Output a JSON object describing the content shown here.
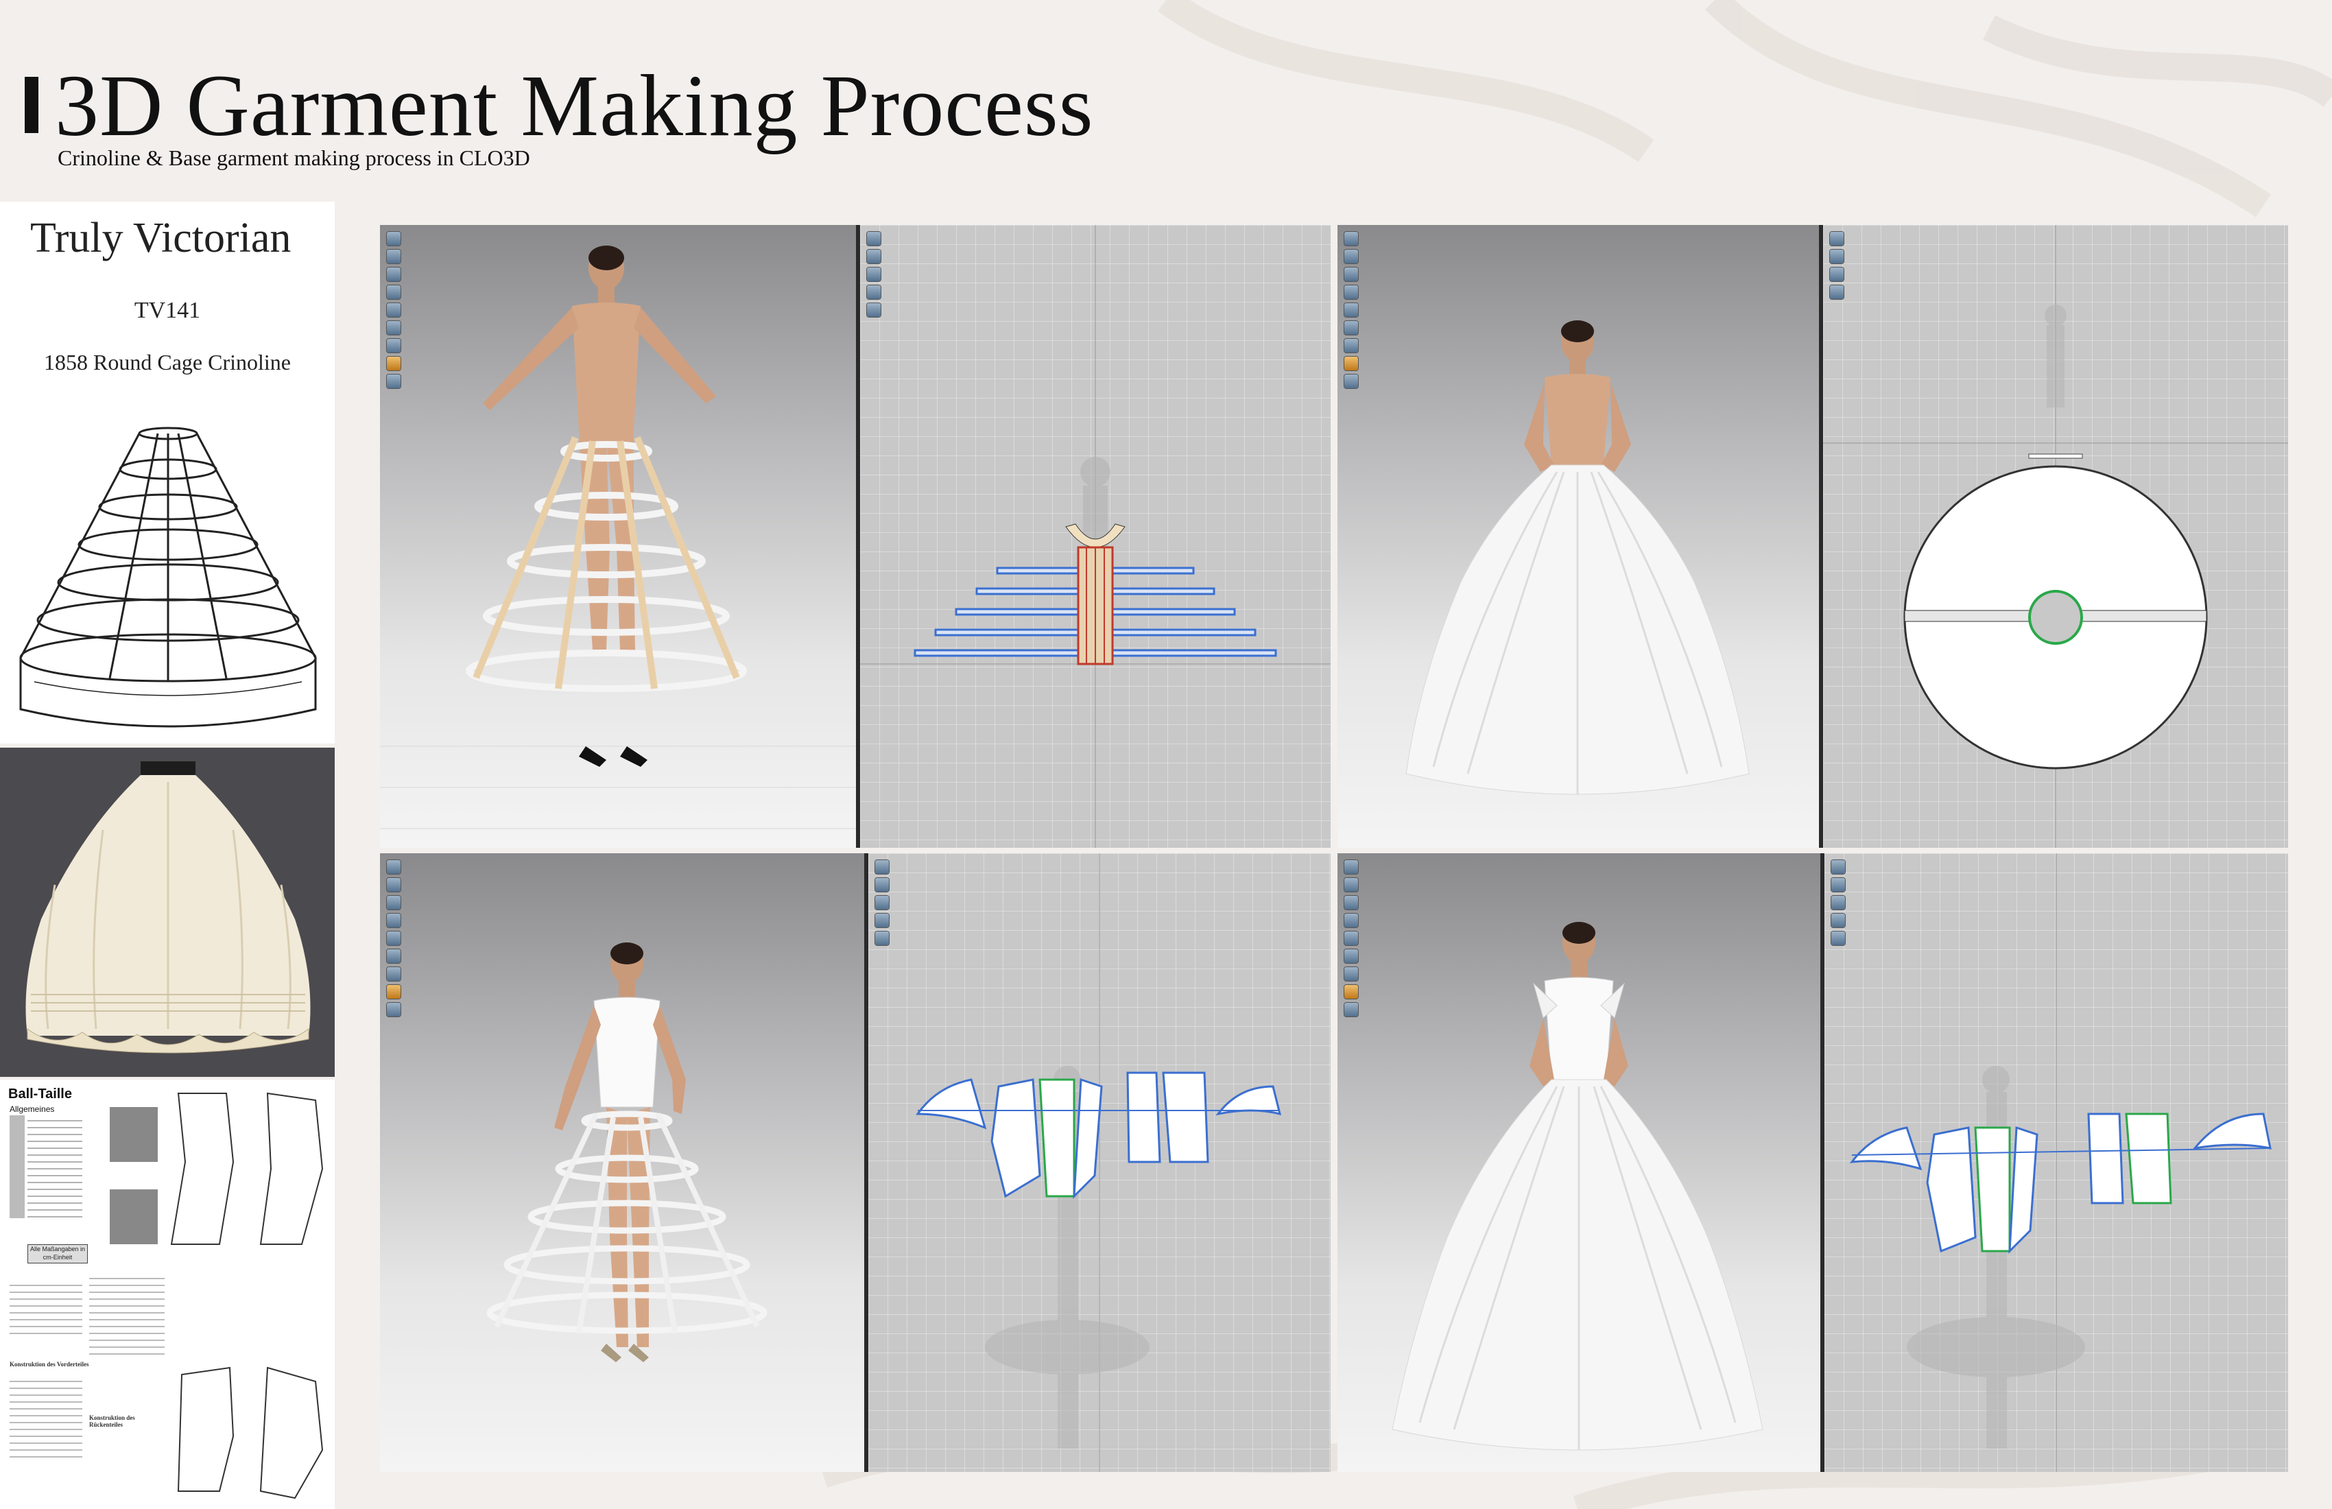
{
  "header": {
    "title": "3D Garment Making Process",
    "subtitle": "Crinoline & Base garment making process in CLO3D"
  },
  "reference": {
    "pattern_brand": "Truly Victorian",
    "pattern_code": "TV141",
    "pattern_name": "1858 Round Cage Crinoline",
    "doc_heading": "Ball-Taille",
    "doc_subheading": "Allgemeines",
    "doc_note": "Alle Maßangaben in cm-Einheit",
    "doc_section_1": "Konstruktion des Vorderteiles",
    "doc_section_2": "Konstruktion des Rückenteiles"
  },
  "colors": {
    "accent_dark": "#111111",
    "viewport_grey": "#c8c8c8",
    "pattern_blue": "#3b6fd0",
    "pattern_red": "#c0392b",
    "seam_green": "#2aa84a"
  },
  "panels": [
    {
      "name": "crinoline-cage",
      "icons": [
        "tool-icon",
        "tool-icon",
        "tool-icon",
        "tool-icon",
        "tool-icon",
        "tool-icon",
        "tool-icon",
        "avatar-icon",
        "tool-icon"
      ]
    },
    {
      "name": "circle-skirt",
      "icons": [
        "tool-icon",
        "tool-icon",
        "tool-icon",
        "tool-icon",
        "tool-icon",
        "tool-icon",
        "tool-icon",
        "avatar-icon",
        "tool-icon"
      ]
    },
    {
      "name": "bodice-over-cage",
      "icons": [
        "tool-icon",
        "tool-icon",
        "tool-icon",
        "tool-icon",
        "tool-icon",
        "tool-icon",
        "tool-icon",
        "avatar-icon",
        "tool-icon"
      ]
    },
    {
      "name": "full-ballgown",
      "icons": [
        "tool-icon",
        "tool-icon",
        "tool-icon",
        "tool-icon",
        "tool-icon",
        "tool-icon",
        "tool-icon",
        "avatar-icon",
        "tool-icon"
      ]
    }
  ]
}
